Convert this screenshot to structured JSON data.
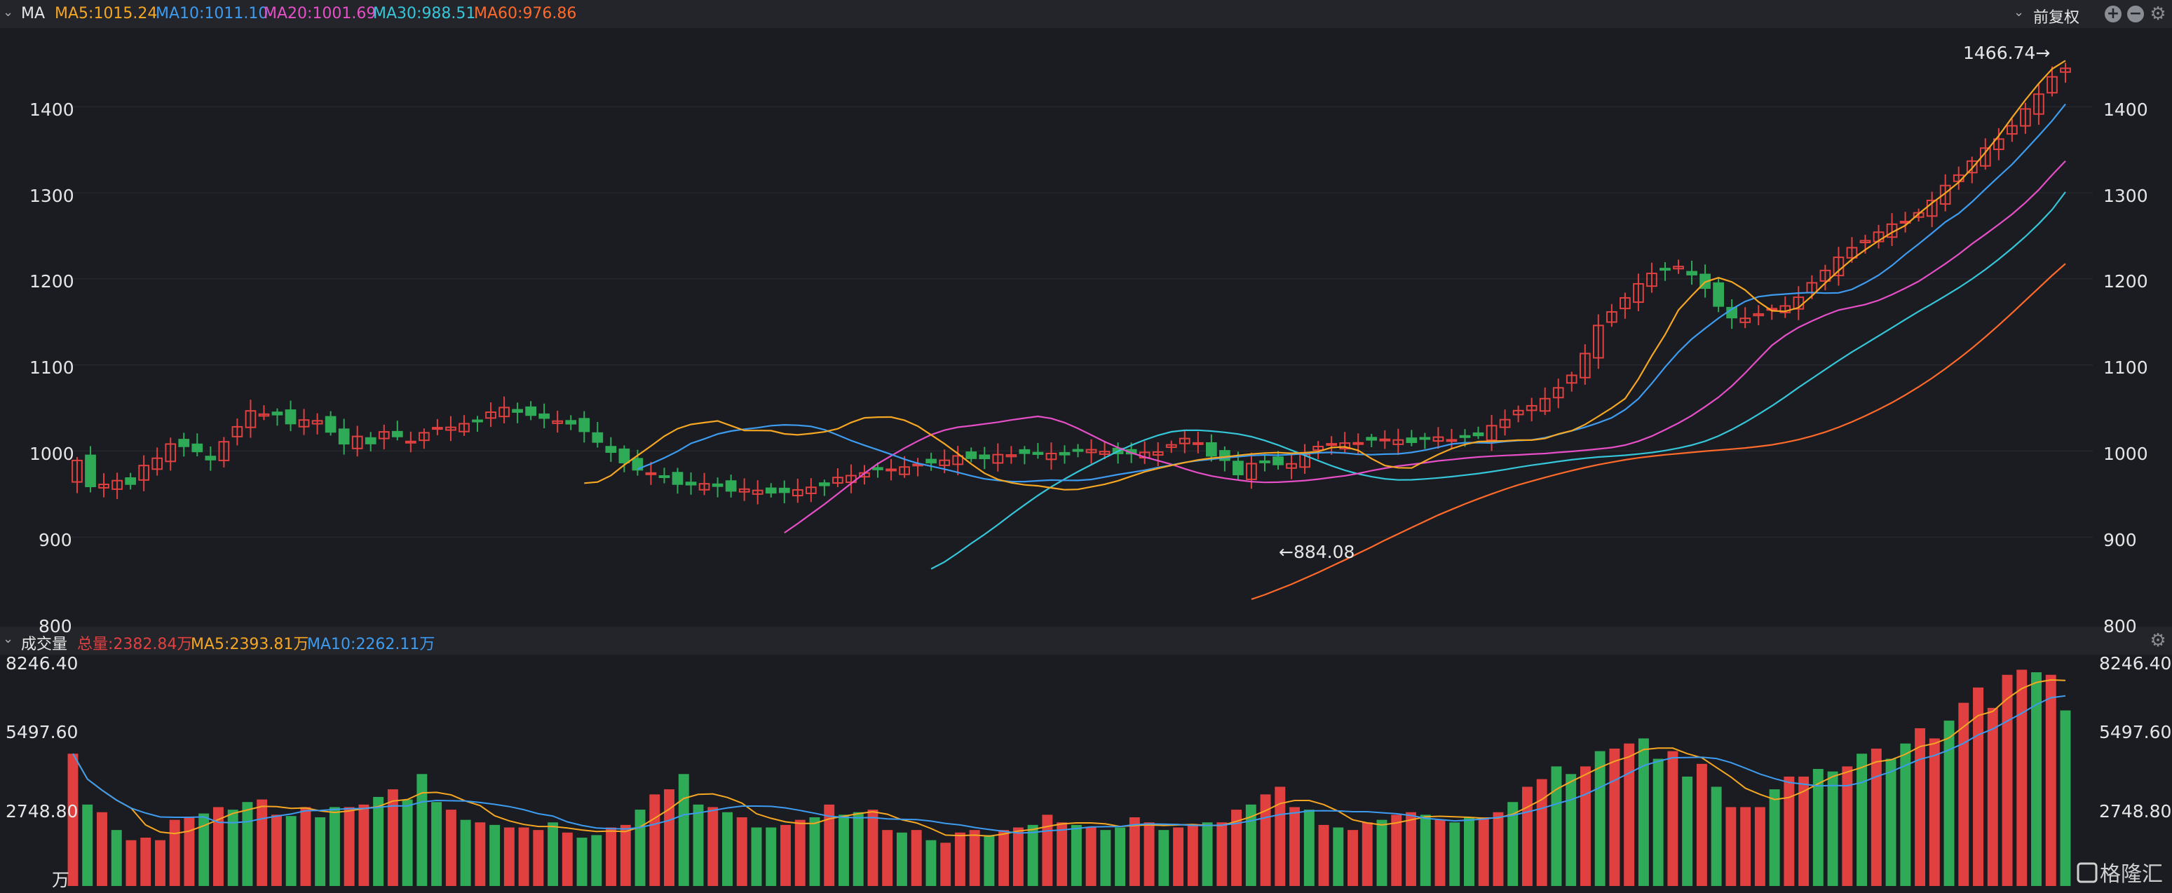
{
  "colors": {
    "up": "#e0403f",
    "down": "#2faa57",
    "ma5": "#f5a623",
    "ma10": "#3d9cf0",
    "ma20": "#e64fc7",
    "ma30": "#36c6d9",
    "ma60": "#ff6a2a",
    "text": "#e6e6e6"
  },
  "header": {
    "indicator": "MA",
    "ma5": "MA5:1015.24",
    "ma10": "MA10:1011.10",
    "ma20": "MA20:1001.69",
    "ma30": "MA30:988.51",
    "ma60": "MA60:976.86",
    "adjust": "前复权",
    "icons": [
      "chevron-down-icon",
      "plus-icon",
      "minus-icon",
      "gear-icon"
    ]
  },
  "volume_header": {
    "title": "成交量",
    "total": "总量:2382.84万",
    "ma5": "MA5:2393.81万",
    "ma10": "MA10:2262.11万",
    "icons": [
      "chevron-down-icon",
      "gear-icon"
    ]
  },
  "annotations": {
    "high": "1466.74→",
    "low": "←884.08"
  },
  "price_axis": {
    "ticks": [
      "1400",
      "1300",
      "1200",
      "1100",
      "1000",
      "900",
      "800"
    ]
  },
  "volume_axis": {
    "ticks": [
      "8246.40",
      "5497.60",
      "2748.80"
    ],
    "unit": "万"
  },
  "watermark": "格隆汇",
  "chart_data": [
    {
      "type": "candlestick",
      "title": "",
      "ylim": [
        800,
        1500
      ],
      "series_names": [
        "MA5",
        "MA10",
        "MA20",
        "MA30",
        "MA60"
      ],
      "close": [
        989.0,
        958.8,
        961.2,
        965.6,
        961.5,
        983.1,
        991.6,
        1008.1,
        1005.4,
        999.4,
        989.9,
        1010.7,
        1028.1,
        1046.6,
        1042.8,
        1042.2,
        1031.8,
        1036.0,
        1035.1,
        1022.1,
        1008.4,
        1016.9,
        1008.6,
        1022.2,
        1016.8,
        1011.1,
        1021.2,
        1027.1,
        1027.5,
        1031.7,
        1034.4,
        1045.1,
        1050.5,
        1045.2,
        1041.6,
        1038.2,
        1034.7,
        1031.6,
        1022.8,
        1010.4,
        998.7,
        986.5,
        978.1,
        974.4,
        969.5,
        961.5,
        960.8,
        961.9,
        959.1,
        953.6,
        955.7,
        954.2,
        951.4,
        952.0,
        954.8,
        957.8,
        960.0,
        969.2,
        971.4,
        974.5,
        978.5,
        978.8,
        981.4,
        984.6,
        986.4,
        989.2,
        994.3,
        991.5,
        991.3,
        995.8,
        995.4,
        997.4,
        996.3,
        997.1,
        995.7,
        1000.6,
        1001.5,
        999.3,
        997.1,
        996.9,
        998.4,
        998.8,
        1007.1,
        1014.5,
        1009.4,
        994.3,
        989.3,
        972.6,
        985.3,
        988.0,
        984.3,
        985.1,
        995.9,
        1005.2,
        1008.4,
        1009.2,
        1009.5,
        1012.9,
        1013.6,
        1012.8,
        1010.1,
        1015.1,
        1016.1,
        1013.0,
        1017.5,
        1018.0,
        1029.4,
        1036.4,
        1046.9,
        1052.5,
        1060.8,
        1073.4,
        1087.9,
        1113.2,
        1145.8,
        1161.6,
        1177.9,
        1194.2,
        1206.3,
        1210.6,
        1214.3,
        1204.8,
        1189.2,
        1168.4,
        1154.9,
        1154.1,
        1159.2,
        1165.4,
        1168.5,
        1178.6,
        1195.4,
        1209.7,
        1225.0,
        1236.2,
        1244.3,
        1254.2,
        1263.5,
        1266.6,
        1276.7,
        1291.1,
        1308.4,
        1320.5,
        1336.8,
        1351.9,
        1362.4,
        1377.8,
        1397.4,
        1414.6,
        1434.7,
        1444.6
      ],
      "ma5": [
        962.6,
        963.9,
        971.4,
        983.8,
        994.8,
        1005.7,
        1017.2,
        1025.9,
        1030.9,
        1033.0,
        1034.9,
        1029.4,
        1023.9,
        1023.8,
        1023.6,
        1019.9,
        1018.7,
        1020.3,
        1022.2,
        1025.8,
        1033.1,
        1038.5,
        1039.3,
        1039.4,
        1035.7,
        1028.8,
        1018.7,
        1008.3,
        997.0,
        984.9,
        974.1,
        967.0,
        963.1,
        960.7,
        959.5,
        957.2,
        955.0,
        955.4,
        958.3,
        961.3,
        965.4,
        970.7,
        975.8,
        979.7,
        983.3,
        986.6,
        989.6,
        991.7,
        993.0,
        994.9,
        996.5,
        997.6,
        998.1,
        997.4,
        998.0,
        999.3,
        1004.0,
        1004.8,
        1000.7,
        991.1,
        983.1,
        980.5,
        980.2,
        988.3,
        995.9,
        1002.7,
        1007.6,
        1010.9,
        1011.3,
        1011.7,
        1012.6,
        1012.6,
        1014.5,
        1019.7,
        1023.5,
        1030.7,
        1040.2,
        1050.0,
        1060.8,
        1083.6,
        1110.5,
        1135.3,
        1163.7,
        1180.5,
        1196.3,
        1201.3,
        1196.4,
        1187.0,
        1173.3,
        1162.9,
        1162.2,
        1166.5,
        1180.1,
        1195.1,
        1209.4,
        1222.6,
        1233.8,
        1244.2,
        1253.9,
        1262.0,
        1275.5,
        1288.1,
        1299.6,
        1312.1,
        1328.3,
        1346.9,
        1366.1,
        1387.4,
        1407.8,
        1426.9,
        1443.8,
        1453.5
      ],
      "ma10": [
        978.9,
        985.1,
        992.0,
        999.7,
        1008.8,
        1014.0,
        1019.7,
        1023.1,
        1025.3,
        1027.0,
        1029.4,
        1030.4,
        1029.9,
        1028.6,
        1024.7,
        1018.6,
        1012.1,
        1006.6,
        1001.4,
        996.1,
        990.4,
        985.7,
        982.3,
        978.9,
        975.2,
        971.2,
        967.6,
        965.8,
        964.5,
        964.4,
        965.4,
        966.2,
        965.9,
        965.8,
        966.9,
        969.7,
        972.6,
        975.1,
        977.7,
        980.8,
        983.6,
        986.7,
        988.8,
        990.4,
        992.2,
        993.4,
        994.8,
        995.4,
        995.1,
        995.9,
        996.8,
        997.9,
        998.4,
        997.6,
        996.1,
        995.7,
        996.3,
        996.7,
        998.3,
        1001.0,
        1004.3,
        1008.1,
        1009.6,
        1009.7,
        1009.3,
        1011.0,
        1012.1,
        1012.9,
        1015.4,
        1019.3,
        1023.4,
        1027.7,
        1032.7,
        1038.6,
        1048.0,
        1060.6,
        1078.4,
        1097.5,
        1115.0,
        1130.1,
        1142.4,
        1154.2,
        1164.9,
        1173.7,
        1179.2,
        1181.2,
        1182.3,
        1183.5,
        1184.1,
        1183.4,
        1183.7,
        1187.7,
        1195.4,
        1204.2,
        1215.5,
        1228.5,
        1240.5,
        1253.1,
        1266.0,
        1275.9,
        1289.4,
        1304.2,
        1318.7,
        1333.0,
        1349.5,
        1366.3,
        1383.6,
        1402.9
      ],
      "ma20": [
        905.0,
        915.6,
        926.9,
        938.1,
        950.2,
        962.2,
        974.0,
        985.2,
        994.4,
        1003.3,
        1011.5,
        1018.9,
        1024.2,
        1027.6,
        1029.3,
        1031.4,
        1033.5,
        1036.0,
        1038.2,
        1040.2,
        1037.9,
        1033.0,
        1026.1,
        1018.6,
        1010.8,
        1004.0,
        997.8,
        992.9,
        988.8,
        984.5,
        979.3,
        974.7,
        970.9,
        968.3,
        966.2,
        964.3,
        963.5,
        963.8,
        964.6,
        965.6,
        967.3,
        969.3,
        971.2,
        973.9,
        977.2,
        980.0,
        982.5,
        984.4,
        986.4,
        988.5,
        990.0,
        991.7,
        993.0,
        994.0,
        994.8,
        995.4,
        996.3,
        997.1,
        998.4,
        999.5,
        1000.8,
        1002.4,
        1004.0,
        1006.8,
        1011.4,
        1017.3,
        1024.7,
        1032.4,
        1041.2,
        1051.5,
        1062.4,
        1075.5,
        1090.6,
        1106.8,
        1122.7,
        1134.1,
        1143.6,
        1151.0,
        1157.8,
        1163.7,
        1166.9,
        1170.2,
        1175.0,
        1181.7,
        1189.2,
        1197.1,
        1207.2,
        1217.5,
        1228.5,
        1240.6,
        1251.7,
        1263.2,
        1275.1,
        1288.5,
        1303.4,
        1320.7,
        1336.9
      ],
      "ma30": [
        863.0,
        871.1,
        881.5,
        892.5,
        903.1,
        914.3,
        926.1,
        937.4,
        948.3,
        958.3,
        967.4,
        976.0,
        984.0,
        992.0,
        999.7,
        1006.7,
        1012.9,
        1018.2,
        1022.3,
        1024.0,
        1024.1,
        1023.1,
        1021.7,
        1019.7,
        1016.6,
        1012.2,
        1006.9,
        1000.9,
        994.9,
        988.8,
        982.8,
        977.6,
        973.4,
        970.1,
        967.7,
        966.4,
        966.5,
        967.5,
        968.7,
        970.2,
        972.0,
        973.8,
        976.0,
        978.4,
        981.0,
        983.5,
        985.6,
        987.8,
        989.8,
        991.5,
        993.0,
        994.0,
        995.0,
        996.5,
        998.2,
        1000.5,
        1003.3,
        1006.8,
        1011.4,
        1017.4,
        1024.9,
        1033.4,
        1042.6,
        1052.4,
        1062.8,
        1073.8,
        1084.2,
        1094.6,
        1105.0,
        1115.0,
        1124.3,
        1133.7,
        1143.2,
        1152.8,
        1162.1,
        1171.0,
        1180.1,
        1189.6,
        1199.8,
        1210.8,
        1222.7,
        1235.6,
        1249.1,
        1263.9,
        1280.4,
        1300.9
      ],
      "ma60": [
        827.8,
        833.0,
        839.1,
        845.2,
        852.0,
        858.9,
        866.2,
        873.4,
        881.0,
        888.4,
        896.3,
        903.7,
        911.1,
        918.3,
        925.6,
        932.1,
        938.4,
        944.4,
        950.1,
        955.5,
        960.6,
        965.0,
        969.2,
        973.3,
        977.2,
        980.8,
        984.1,
        987.0,
        989.7,
        992.0,
        993.9,
        995.6,
        997.0,
        998.4,
        999.8,
        1001.0,
        1002.2,
        1003.5,
        1005.2,
        1007.2,
        1009.9,
        1013.2,
        1017.3,
        1022.0,
        1027.5,
        1033.8,
        1040.7,
        1048.2,
        1056.2,
        1065.0,
        1074.4,
        1084.6,
        1095.6,
        1107.2,
        1119.5,
        1132.5,
        1146.2,
        1160.3,
        1174.8,
        1189.3,
        1203.9,
        1217.6
      ],
      "high_label": 1466.74,
      "low_label": 884.08
    },
    {
      "type": "bar",
      "title": "成交量",
      "unit": "万",
      "ylim": [
        0,
        8800
      ],
      "values": [
        5200,
        3200,
        2900,
        2200,
        1800,
        1900,
        1800,
        2600,
        2700,
        2850,
        3100,
        3000,
        3300,
        3400,
        2800,
        2750,
        3100,
        2700,
        3100,
        3100,
        3200,
        3500,
        3800,
        3400,
        4400,
        3300,
        3000,
        2600,
        2500,
        2400,
        2300,
        2300,
        2200,
        2500,
        2100,
        1900,
        2000,
        2300,
        2400,
        3000,
        3600,
        3800,
        4400,
        3200,
        3100,
        2900,
        2700,
        2300,
        2300,
        2400,
        2600,
        2700,
        3200,
        2800,
        2900,
        3000,
        2200,
        2100,
        2200,
        1800,
        1700,
        2100,
        2200,
        2000,
        2200,
        2300,
        2400,
        2800,
        2500,
        2400,
        2300,
        2200,
        2300,
        2700,
        2500,
        2200,
        2300,
        2400,
        2500,
        2500,
        3000,
        3200,
        3600,
        3900,
        3100,
        3000,
        2400,
        2300,
        2200,
        2500,
        2600,
        2800,
        2900,
        2800,
        2600,
        2500,
        2700,
        2700,
        2900,
        3300,
        3900,
        4200,
        4700,
        4400,
        4700,
        5300,
        5400,
        5600,
        5800,
        5000,
        5300,
        4300,
        4800,
        3900,
        3100,
        3100,
        3100,
        3800,
        4300,
        4300,
        4600,
        4500,
        4700,
        5200,
        5400,
        5000,
        5600,
        6200,
        5800,
        6500,
        7200,
        7800,
        7000,
        8300,
        8500,
        8400,
        8300,
        6900
      ],
      "ma5_last": 2393.81,
      "ma10_last": 2262.11
    }
  ]
}
